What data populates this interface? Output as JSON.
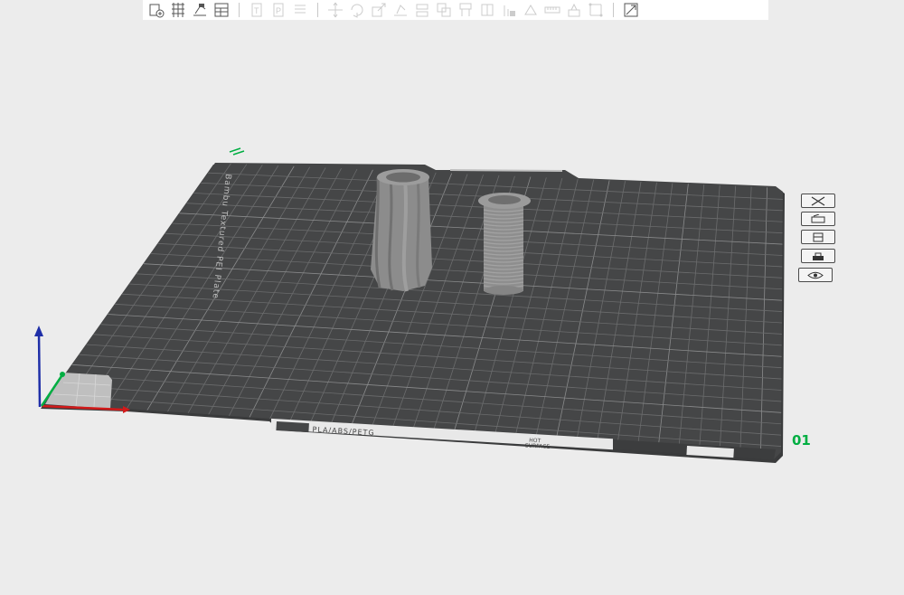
{
  "toolbar": {
    "buttons": [
      {
        "name": "add-plate-icon"
      },
      {
        "name": "arrange-grid-icon"
      },
      {
        "name": "orient-icon"
      },
      {
        "name": "layers-table-icon"
      },
      {
        "sep": true
      },
      {
        "name": "text-object-icon"
      },
      {
        "name": "parameter-object-icon"
      },
      {
        "name": "menu-list-icon"
      },
      {
        "sep": true
      },
      {
        "name": "move-icon"
      },
      {
        "name": "rotate-icon"
      },
      {
        "name": "scale-icon"
      },
      {
        "name": "lay-on-face-icon"
      },
      {
        "name": "cut-icon"
      },
      {
        "name": "mesh-boolean-icon"
      },
      {
        "name": "support-paint-icon"
      },
      {
        "name": "seam-paint-icon"
      },
      {
        "name": "color-paint-icon"
      },
      {
        "name": "emboss-icon"
      },
      {
        "name": "measure-icon"
      },
      {
        "name": "assembly-icon"
      },
      {
        "name": "variable-layer-icon"
      },
      {
        "sep": true
      },
      {
        "name": "split-icon"
      }
    ]
  },
  "plate": {
    "brand_text": "Bambu Textured PEI Plate",
    "filament_text": "PLA/ABS/PETG",
    "hot_surface_line1": "HOT",
    "hot_surface_line2": "SURFACE",
    "number": "01"
  },
  "plate_side_controls": [
    {
      "name": "delete-plate-icon"
    },
    {
      "name": "arrange-plate-icon"
    },
    {
      "name": "orient-plate-icon"
    },
    {
      "name": "lock-plate-icon"
    },
    {
      "name": "plate-settings-eye-icon"
    }
  ],
  "colors": {
    "background": "#ececec",
    "plate": "#454647",
    "grid": "#6b6c6d",
    "model": "#8f8f8f",
    "axis_x": "#d21a1a",
    "axis_y": "#00ae42",
    "axis_z": "#1f2fa8",
    "accent": "#00ae42"
  }
}
